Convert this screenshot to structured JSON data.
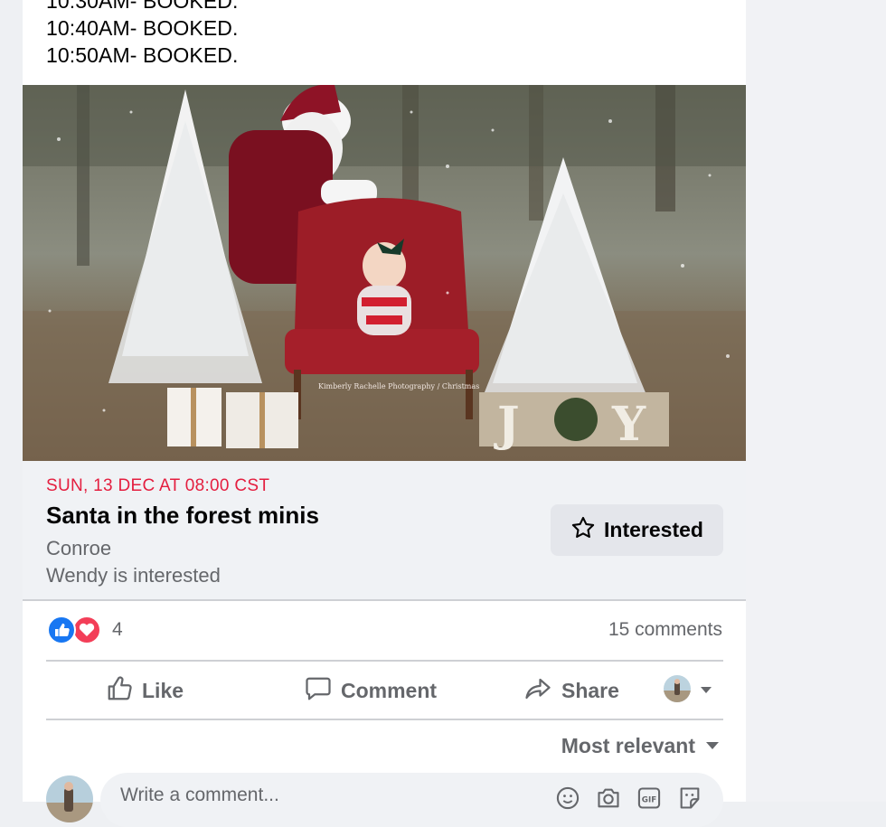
{
  "post": {
    "slots": [
      "10:30AM- BOOKED.",
      "10:40AM- BOOKED.",
      "10:50AM- BOOKED."
    ],
    "watermark": "Kimberly Rachelle Photography / Christmas"
  },
  "event": {
    "date": "SUN, 13 DEC AT 08:00 CST",
    "title": "Santa in the forest minis",
    "location": "Conroe",
    "interest_note": "Wendy is interested",
    "interested_button": "Interested"
  },
  "reactions": {
    "count": "4",
    "comments": "15 comments"
  },
  "actions": {
    "like": "Like",
    "comment": "Comment",
    "share": "Share"
  },
  "comments": {
    "sort_label": "Most relevant",
    "placeholder": "Write a comment..."
  },
  "colors": {
    "date_red": "#e41e3f",
    "like_blue": "#1877f2",
    "love_red": "#f33e58",
    "muted_text": "#65676b"
  },
  "icons": [
    "star-icon",
    "like-reaction-icon",
    "love-reaction-icon",
    "thumbs-up-icon",
    "comment-bubble-icon",
    "share-arrow-icon",
    "chevron-down-icon",
    "emoji-icon",
    "camera-icon",
    "gif-icon",
    "sticker-icon"
  ]
}
